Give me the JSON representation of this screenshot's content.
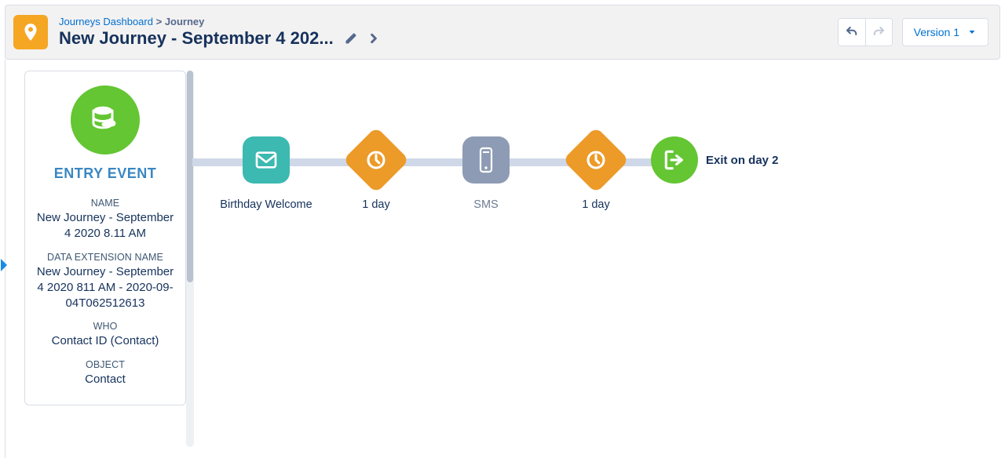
{
  "breadcrumb": {
    "dashboard": "Journeys Dashboard",
    "separator": ">",
    "current": "Journey"
  },
  "title": {
    "text": "New Journey - September 4 202..."
  },
  "toolbar": {
    "version_label": "Version 1"
  },
  "sidebar": {
    "title": "ENTRY EVENT",
    "name_label": "NAME",
    "name_value": "New Journey - September 4 2020 8.11 AM",
    "dataext_label": "DATA EXTENSION NAME",
    "dataext_value": "New Journey - September 4 2020 811 AM - 2020-09-04T062512613",
    "who_label": "WHO",
    "who_value": "Contact ID (Contact)",
    "object_label": "OBJECT",
    "object_value": "Contact"
  },
  "flow": {
    "steps": [
      {
        "type": "email",
        "label": "Birthday Welcome"
      },
      {
        "type": "wait",
        "label": "1 day"
      },
      {
        "type": "sms",
        "label": "SMS"
      },
      {
        "type": "wait",
        "label": "1 day"
      }
    ],
    "exit_label": "Exit on day 2"
  }
}
